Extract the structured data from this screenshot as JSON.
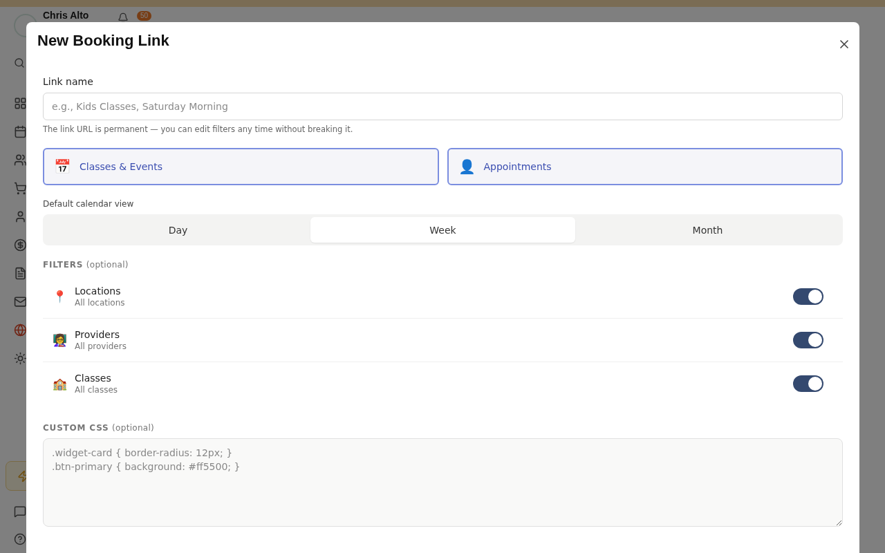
{
  "background": {
    "user_name": "Chris Alto",
    "notification_count": "50",
    "sidebar_items": [
      {
        "kind": "dashboard",
        "selected": false
      },
      {
        "kind": "calendar",
        "selected": false
      },
      {
        "kind": "people",
        "selected": false
      },
      {
        "kind": "cart",
        "selected": false
      },
      {
        "kind": "person",
        "selected": false
      },
      {
        "kind": "money",
        "selected": false
      },
      {
        "kind": "document",
        "selected": false
      },
      {
        "kind": "mail",
        "selected": false
      },
      {
        "kind": "globe",
        "selected": true
      },
      {
        "kind": "settings",
        "selected": false
      }
    ]
  },
  "modal": {
    "title": "New Booking Link",
    "link_name": {
      "label": "Link name",
      "placeholder": "e.g., Kids Classes, Saturday Morning",
      "hint": "The link URL is permanent — you can edit filters any time without breaking it."
    },
    "types": [
      {
        "icon": "📅",
        "label": "Classes & Events",
        "selected": true
      },
      {
        "icon": "👤",
        "label": "Appointments",
        "selected": true
      }
    ],
    "calendar_view": {
      "label": "Default calendar view",
      "options": [
        {
          "label": "Day",
          "selected": false
        },
        {
          "label": "Week",
          "selected": true
        },
        {
          "label": "Month",
          "selected": false
        }
      ]
    },
    "filters": {
      "heading": "FILTERS",
      "optional": "(optional)",
      "items": [
        {
          "icon": "📍",
          "title": "Locations",
          "subtitle": "All locations",
          "on": true
        },
        {
          "icon": "👩‍🏫",
          "title": "Providers",
          "subtitle": "All providers",
          "on": true
        },
        {
          "icon": "🏫",
          "title": "Classes",
          "subtitle": "All classes",
          "on": true
        }
      ]
    },
    "custom_css": {
      "heading": "CUSTOM CSS",
      "optional": "(optional)",
      "placeholder": ".widget-card { border-radius: 12px; }\n.btn-primary { background: #ff5500; }"
    }
  }
}
